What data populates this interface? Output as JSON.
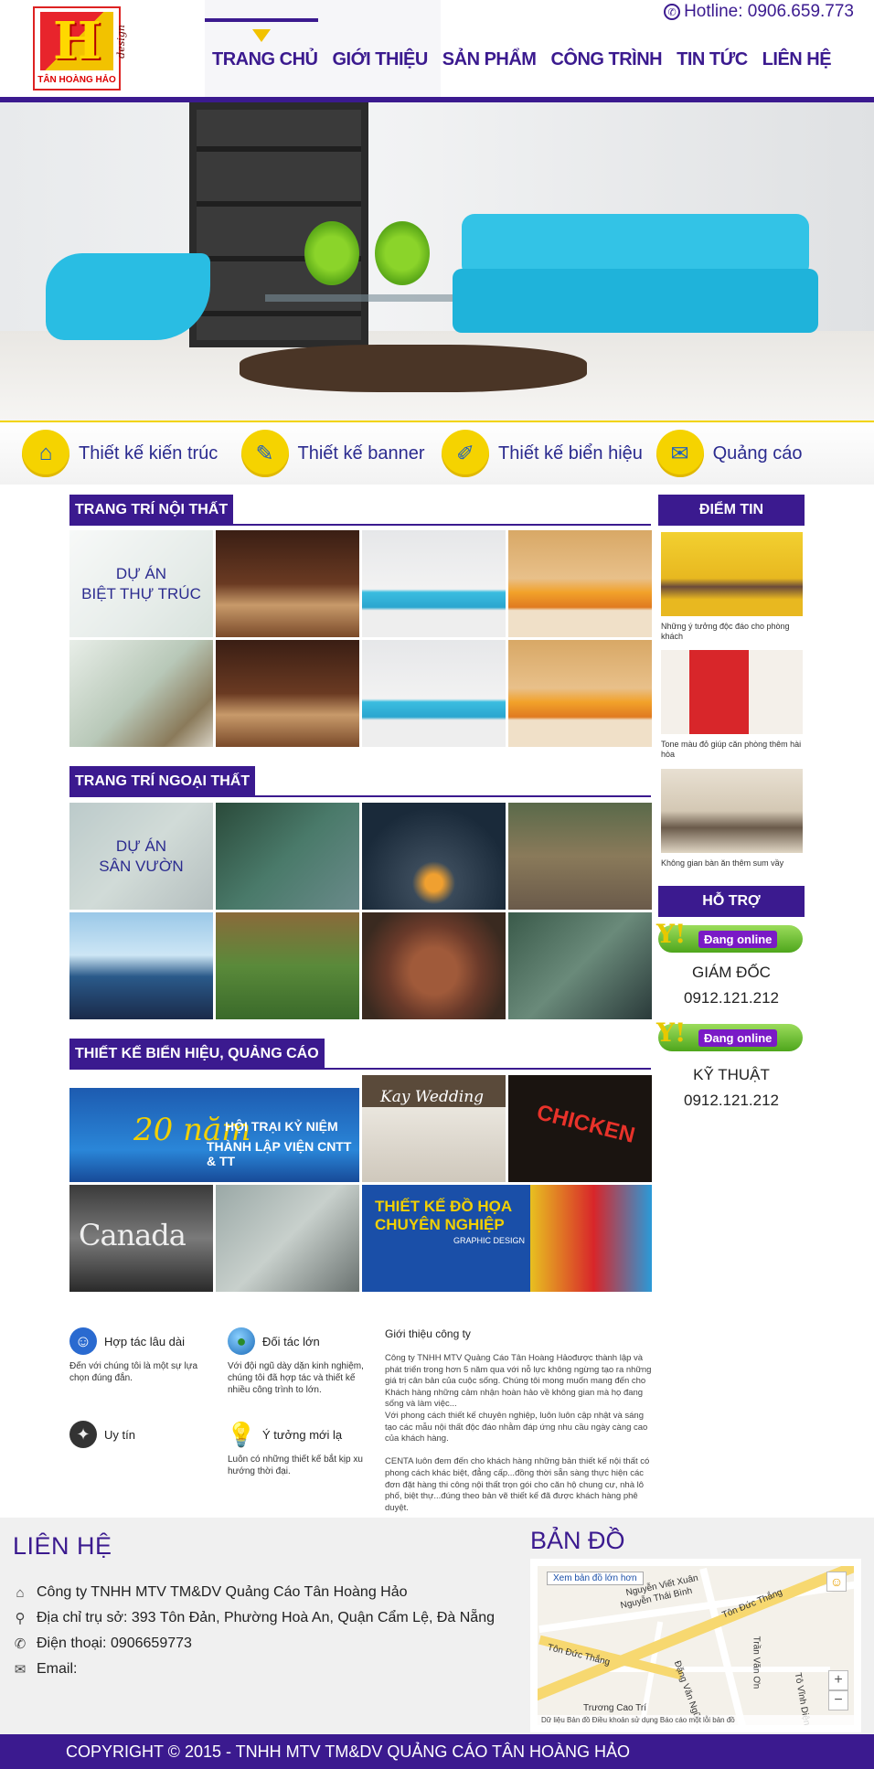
{
  "header": {
    "logo_name": "TÂN HOÀNG HẢO",
    "logo_mark": "H",
    "logo_design": "design",
    "hotline": "Hotline: 0906.659.773",
    "nav": [
      "TRANG CHỦ",
      "GIỚI THIỆU",
      "SẢN PHẨM",
      "CÔNG TRÌNH",
      "TIN TỨC",
      "LIÊN HỆ"
    ]
  },
  "services": [
    {
      "label": "Thiết kế kiến trúc",
      "icon": "architecture-icon"
    },
    {
      "label": "Thiết kế banner",
      "icon": "banner-icon"
    },
    {
      "label": "Thiết kế biển hiệu",
      "icon": "signboard-icon"
    },
    {
      "label": "Quảng cáo",
      "icon": "advertising-icon"
    }
  ],
  "sections": {
    "interior": {
      "title": "TRANG TRÍ NỘI THẤT",
      "caption": "DỰ ÁN\nBIỆT THỰ TRÚC"
    },
    "exterior": {
      "title": "TRANG TRÍ NGOẠI THẤT",
      "caption": "DỰ ÁN\nSÂN VƯỜN"
    },
    "signage": {
      "title": "THIẾT KẾ BIỂN HIỆU, QUẢNG CÁO"
    }
  },
  "signage_texts": {
    "banner_title": "HỘI TRẠI KỶ NIỆM",
    "banner_sub": "THÀNH LẬP VIỆN CNTT & TT",
    "banner_years": "20 năm",
    "shop": "Kay Wedding",
    "chicken": "CHICKEN",
    "canada": "Canada",
    "graphic_title": "THIẾT KẾ ĐỒ HỌA",
    "graphic_sub": "CHUYÊN NGHIỆP",
    "graphic_en": "GRAPHIC DESIGN"
  },
  "sidebar": {
    "news_title": "ĐIỂM TIN",
    "news": [
      "Những ý tưởng độc đáo cho phòng khách",
      "Tone màu đỏ giúp căn phòng thêm hài hòa",
      "Không gian bàn ăn thêm sum vầy"
    ],
    "support_title": "HỖ TRỢ",
    "online_label": "Đang online",
    "contacts": [
      {
        "role": "GIÁM ĐỐC",
        "phone": "0912.121.212"
      },
      {
        "role": "KỸ THUẬT",
        "phone": "0912.121.212"
      }
    ]
  },
  "features": [
    {
      "title": "Hợp tác lâu dài",
      "desc": "Đến với chúng tôi là một sự lựa chọn đúng đắn.",
      "icon": "user-icon"
    },
    {
      "title": "Đối tác lớn",
      "desc": "Với đội ngũ dày dặn kinh nghiệm, chúng tôi đã hợp tác và thiết kế nhiều công trình to lớn.",
      "icon": "globe-icon"
    },
    {
      "title": "Uy tín",
      "desc": "",
      "icon": "compass-icon"
    },
    {
      "title": "Ý tưởng mới lạ",
      "desc": "Luôn có những thiết kế bắt kịp xu hướng thời đại.",
      "icon": "lightbulb-icon"
    }
  ],
  "intro": {
    "title": "Giới thiệu công ty",
    "text": "Công ty TNHH MTV Quảng Cáo Tân Hoàng Hảođược thành lập và phát triển trong hơn 5 năm qua với nỗ lực không ngừng tạo ra những giá trị cân bản của cuộc sống. Chúng tôi mong muốn mang đến cho Khách hàng những cảm nhận hoàn hảo về không gian mà họ đang sống và làm việc...\nVới phong cách thiết kế chuyên nghiệp, luôn luôn cập nhật và sáng tạo các mẫu nội thất độc đáo nhằm đáp ứng nhu cầu ngày càng cao của khách hàng.\n\nCENTA luôn đem đến cho khách hàng những bản thiết kế nội thất có phong cách khác biệt, đẳng cấp...đồng thời sẵn sàng thực hiện các đơn đặt hàng thi công nội thất trọn gói cho căn hộ chung cư, nhà lô phố, biệt thự...đúng theo bản vẽ thiết kế đã được khách hàng phê duyệt."
  },
  "contact": {
    "title": "LIÊN HỆ",
    "company": "Công ty TNHH MTV TM&DV Quảng Cáo Tân Hoàng Hảo",
    "address": "Địa chỉ trụ sở: 393 Tôn Đản, Phường Hoà An, Quận Cẩm Lệ, Đà Nẵng",
    "phone": "Điện thoại: 0906659773",
    "email": "Email:"
  },
  "map": {
    "title": "BẢN ĐỒ",
    "link": "Xem bản đồ lớn hơn",
    "streets": [
      "Tôn Đức Thắng",
      "Nguyễn Thái Bình",
      "Nguyễn Viết Xuân",
      "Trần Văn Ơn",
      "Trương Cao Trí",
      "Đặng Văn Ngữ",
      "Tô Vĩnh Diện"
    ],
    "footer": "Dữ liệu Bản đồ   Điều khoản sử dụng   Báo cáo một lỗi bản đồ"
  },
  "copyright": "COPYRIGHT © 2015 - TNHH MTV TM&DV QUẢNG CÁO TÂN HOÀNG HẢO"
}
